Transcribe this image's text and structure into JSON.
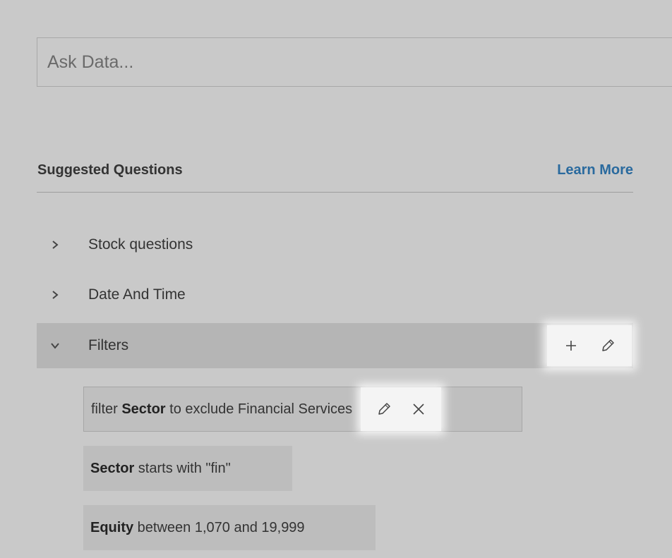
{
  "search": {
    "placeholder": "Ask Data..."
  },
  "suggested": {
    "title": "Suggested Questions",
    "learn_more": "Learn More"
  },
  "groups": [
    {
      "label": "Stock questions",
      "state": "collapsed"
    },
    {
      "label": "Date And Time",
      "state": "collapsed"
    },
    {
      "label": "Filters",
      "state": "expanded"
    }
  ],
  "questions": [
    {
      "field": "Sector",
      "prefix": "filter ",
      "suffix": " to exclude Financial Services"
    },
    {
      "field": "Sector",
      "prefix": "",
      "suffix": " starts with \"fin\""
    },
    {
      "field": "Equity",
      "prefix": "",
      "suffix": " between 1,070 and 19,999"
    }
  ],
  "icons": {
    "collapsed_chevron": "chevron-right-icon",
    "expanded_chevron": "chevron-down-icon",
    "add": "plus-icon",
    "edit": "pencil-icon",
    "remove": "close-icon"
  },
  "colors": {
    "background": "#c9c9c9",
    "link": "#2a6a9e",
    "highlight": "#f4f4f4",
    "expanded_row": "#b5b5b5",
    "pill": "#bdbdbd"
  }
}
